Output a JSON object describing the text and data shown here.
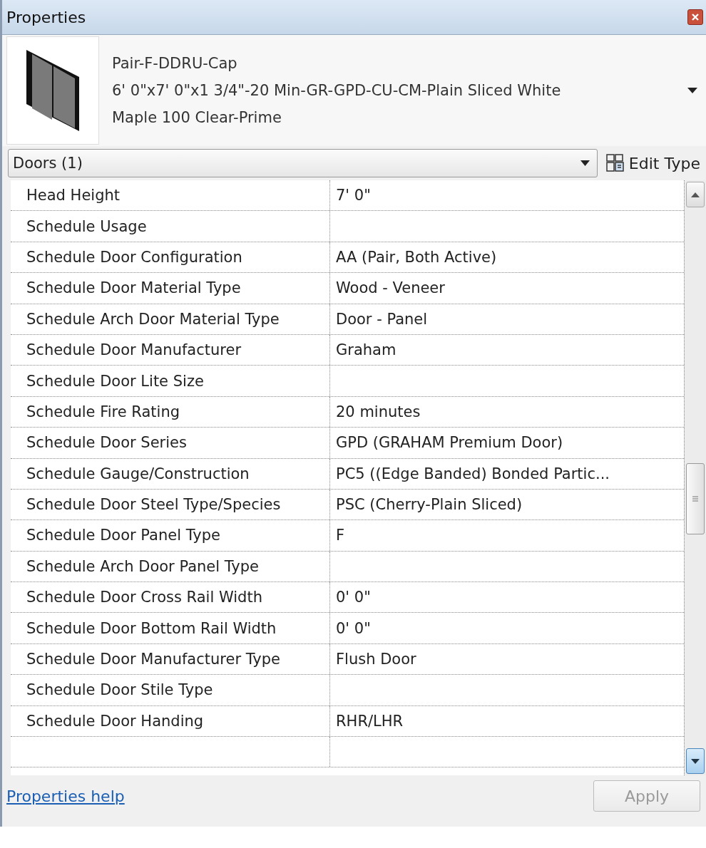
{
  "window": {
    "title": "Properties"
  },
  "type_selector": {
    "family": "Pair-F-DDRU-Cap",
    "type_lines": [
      "6' 0\"x7' 0\"x1 3/4\"-20 Min-GR-GPD-CU-CM-Plain Sliced White",
      "Maple 100 Clear-Prime"
    ]
  },
  "filter": {
    "value": "Doors (1)"
  },
  "edit_type_button": {
    "label": "Edit Type"
  },
  "properties": [
    {
      "name": "Head Height",
      "value": "7'  0\""
    },
    {
      "name": "Schedule Usage"
    },
    {
      "name": "Schedule Door Configuration",
      "value": "AA (Pair, Both Active)"
    },
    {
      "name": "Schedule Door Material Type",
      "value": "Wood - Veneer"
    },
    {
      "name": "Schedule Arch Door Material Type",
      "value": "Door - Panel"
    },
    {
      "name": "Schedule Door Manufacturer",
      "value": "Graham"
    },
    {
      "name": "Schedule Door Lite Size"
    },
    {
      "name": "Schedule Fire Rating",
      "value": "20 minutes"
    },
    {
      "name": "Schedule Door Series",
      "value": "GPD (GRAHAM Premium Door)"
    },
    {
      "name": "Schedule Gauge/Construction",
      "value": "PC5 ((Edge Banded) Bonded Partic..."
    },
    {
      "name": "Schedule Door Steel Type/Species",
      "value": "PSC (Cherry-Plain Sliced)"
    },
    {
      "name": "Schedule Door Panel Type",
      "value": "F"
    },
    {
      "name": "Schedule Arch Door Panel Type"
    },
    {
      "name": "Schedule Door Cross Rail Width",
      "value": "0'  0\""
    },
    {
      "name": "Schedule Door Bottom Rail Width",
      "value": "0'  0\""
    },
    {
      "name": "Schedule Door Manufacturer Type",
      "value": "Flush Door"
    },
    {
      "name": "Schedule Door Stile Type"
    },
    {
      "name": "Schedule Door Handing",
      "value": "RHR/LHR"
    }
  ],
  "footer": {
    "help_link": "Properties help",
    "apply_button": {
      "label": "Apply",
      "disabled": true
    }
  }
}
